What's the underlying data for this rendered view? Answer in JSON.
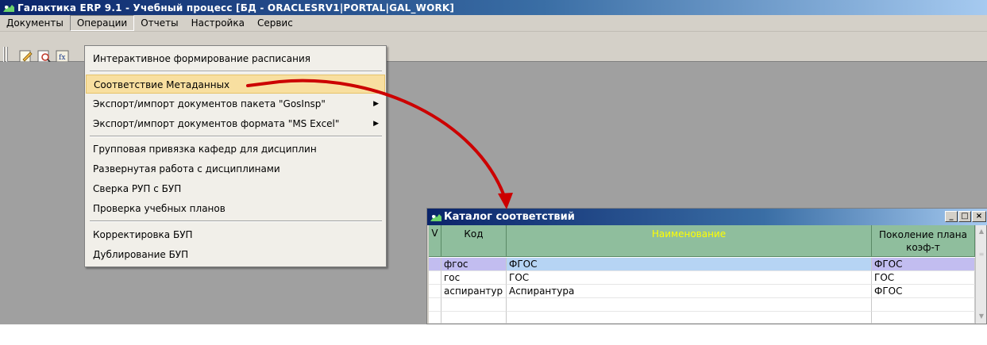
{
  "window": {
    "title": "Галактика ERP 9.1 - Учебный процесс [БД - ORACLESRV1|PORTAL|GAL_WORK]"
  },
  "menubar": {
    "items": [
      {
        "label": "Документы"
      },
      {
        "label": "Операции"
      },
      {
        "label": "Отчеты"
      },
      {
        "label": "Настройка"
      },
      {
        "label": "Сервис"
      }
    ]
  },
  "operations_menu": {
    "items": [
      {
        "label": "Интерактивное формирование расписания",
        "submenu": false
      },
      {
        "label": "Соответствие Метаданных",
        "submenu": false,
        "highlighted": true
      },
      {
        "label": "Экспорт/импорт документов пакета \"GosInsp\"",
        "submenu": true
      },
      {
        "label": "Экспорт/импорт документов формата \"MS Excel\"",
        "submenu": true
      },
      {
        "label": "Групповая привязка кафедр для дисциплин",
        "submenu": false
      },
      {
        "label": "Развернутая работа с дисциплинами",
        "submenu": false
      },
      {
        "label": "Сверка РУП с БУП",
        "submenu": false
      },
      {
        "label": "Проверка учебных планов",
        "submenu": false
      },
      {
        "label": "Корректировка БУП",
        "submenu": false
      },
      {
        "label": "Дублирование БУП",
        "submenu": false
      }
    ]
  },
  "catalog": {
    "title": "Каталог соответствий",
    "columns": {
      "mark": "V",
      "code": "Код",
      "name": "Наименование",
      "gen_line1": "Поколение плана",
      "gen_line2": "коэф-т"
    },
    "rows": [
      {
        "code": "фгос",
        "name": "ФГОС",
        "gen": "ФГОС",
        "selected": true
      },
      {
        "code": "гос",
        "name": "ГОС",
        "gen": "ГОС",
        "selected": false
      },
      {
        "code": "аспирантур",
        "name": "Аспирантура",
        "gen": "ФГОС",
        "selected": false
      }
    ],
    "window_buttons": {
      "minimize": "_",
      "maximize": "□",
      "close": "×"
    }
  },
  "colors": {
    "titlebar": "#0a246a",
    "header_fill": "#8fbe9d",
    "name_header_text": "#ffff00",
    "menu_highlight": "#f8dfa0",
    "annotation_arrow": "#cc0000"
  },
  "icons": [
    "app-icon",
    "edit-icon",
    "preview-icon",
    "formula-icon",
    "submenu-arrow-icon"
  ]
}
